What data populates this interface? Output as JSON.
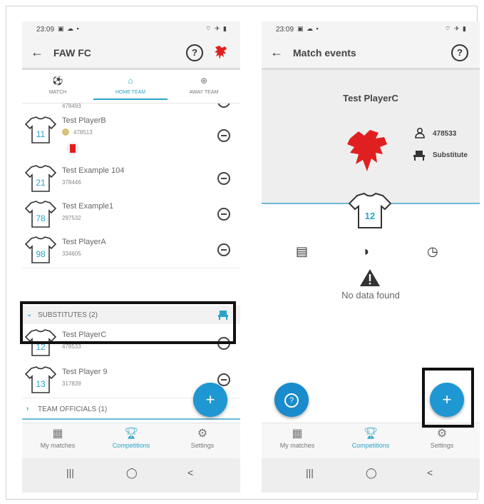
{
  "left": {
    "status_time": "23:09",
    "status_icons_left": "▣ ☁ ▪",
    "status_icons_right": "⌔ ✈ ▮",
    "title": "FAW FC",
    "tabs": [
      {
        "label": "MATCH"
      },
      {
        "label": "HOME TEAM"
      },
      {
        "label": "AWAY TEAM"
      }
    ],
    "partial_row": {
      "id": "478493"
    },
    "players": [
      {
        "number": "11",
        "name": "Test PlayerB",
        "id": "478513"
      },
      {
        "number": "21",
        "name": "Test Example 104",
        "id": "378446"
      },
      {
        "number": "78",
        "name": "Test Example1",
        "id": "297532"
      },
      {
        "number": "98",
        "name": "Test PlayerA",
        "id": "334605"
      }
    ],
    "substitutes_header": "SUBSTITUTES (2)",
    "substitutes": [
      {
        "number": "12",
        "name": "Test PlayerC",
        "id": "478533"
      },
      {
        "number": "13",
        "name": "Test Player 9",
        "id": "317839"
      }
    ],
    "officials_header": "TEAM OFFICIALS (1)"
  },
  "right": {
    "status_time": "23:09",
    "status_icons_left": "▣ ☁ ▪",
    "status_icons_right": "⌔ ✈ ▮",
    "title": "Match events",
    "player_name": "Test PlayerC",
    "player_id": "478533",
    "player_position": "Substitute",
    "shirt_number": "12",
    "empty_message": "No data found"
  },
  "nav": [
    {
      "label": "My matches",
      "icon": "grid-calendar-icon"
    },
    {
      "label": "Competitions",
      "icon": "trophy-icon"
    },
    {
      "label": "Settings",
      "icon": "gear-icon"
    }
  ],
  "sysnav": {
    "recent": "|||",
    "home": "◯",
    "back": "<"
  },
  "colors": {
    "accent": "#2aa3c7",
    "fab": "#1e97d2",
    "card_red": "#e01e1e",
    "crest_red": "#e02020"
  }
}
